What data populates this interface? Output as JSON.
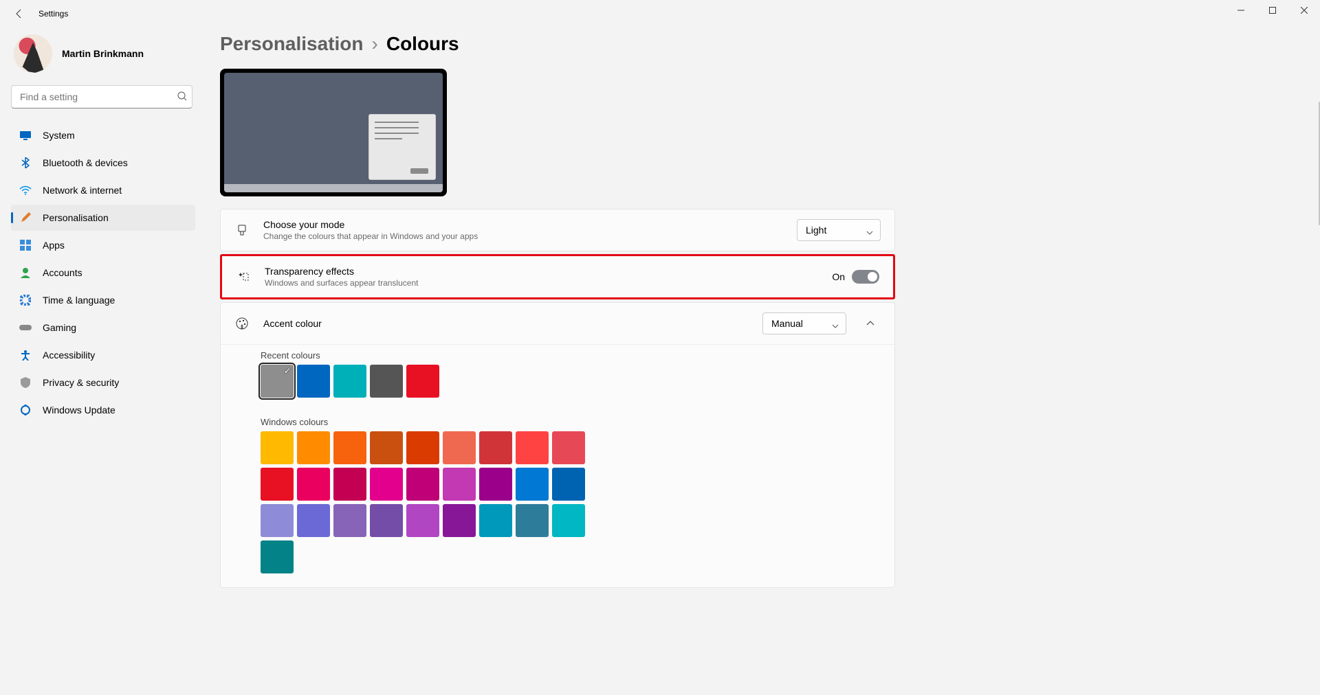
{
  "app_title": "Settings",
  "user": {
    "name": "Martin Brinkmann"
  },
  "search": {
    "placeholder": "Find a setting"
  },
  "nav": [
    {
      "icon": "system",
      "label": "System"
    },
    {
      "icon": "bluetooth",
      "label": "Bluetooth & devices"
    },
    {
      "icon": "network",
      "label": "Network & internet"
    },
    {
      "icon": "personalisation",
      "label": "Personalisation"
    },
    {
      "icon": "apps",
      "label": "Apps"
    },
    {
      "icon": "accounts",
      "label": "Accounts"
    },
    {
      "icon": "time",
      "label": "Time & language"
    },
    {
      "icon": "gaming",
      "label": "Gaming"
    },
    {
      "icon": "accessibility",
      "label": "Accessibility"
    },
    {
      "icon": "privacy",
      "label": "Privacy & security"
    },
    {
      "icon": "update",
      "label": "Windows Update"
    }
  ],
  "active_nav_index": 3,
  "breadcrumb": {
    "parent": "Personalisation",
    "current": "Colours",
    "sep": "›"
  },
  "choose_mode": {
    "title": "Choose your mode",
    "desc": "Change the colours that appear in Windows and your apps",
    "value": "Light"
  },
  "transparency": {
    "title": "Transparency effects",
    "desc": "Windows and surfaces appear translucent",
    "state_label": "On",
    "on": true
  },
  "accent": {
    "title": "Accent colour",
    "value": "Manual",
    "recent_label": "Recent colours",
    "recent_colours": [
      "#8e8e8e",
      "#0067c0",
      "#00b0b9",
      "#555555",
      "#e81123"
    ],
    "recent_selected_index": 0,
    "windows_label": "Windows colours",
    "windows_colours": [
      "#ffb900",
      "#ff8c00",
      "#f7630c",
      "#ca5010",
      "#da3b01",
      "#ef6950",
      "#d13438",
      "#ff4343",
      "#e74856",
      "#e81123",
      "#ea005e",
      "#c30052",
      "#e3008c",
      "#bf0077",
      "#c239b3",
      "#9a0089",
      "#0078d4",
      "#0063b1",
      "#8e8cd8",
      "#6b69d6",
      "#8764b8",
      "#744da9",
      "#b146c2",
      "#881798",
      "#0099bc",
      "#2d7d9a",
      "#00b7c3",
      "#038387"
    ]
  }
}
